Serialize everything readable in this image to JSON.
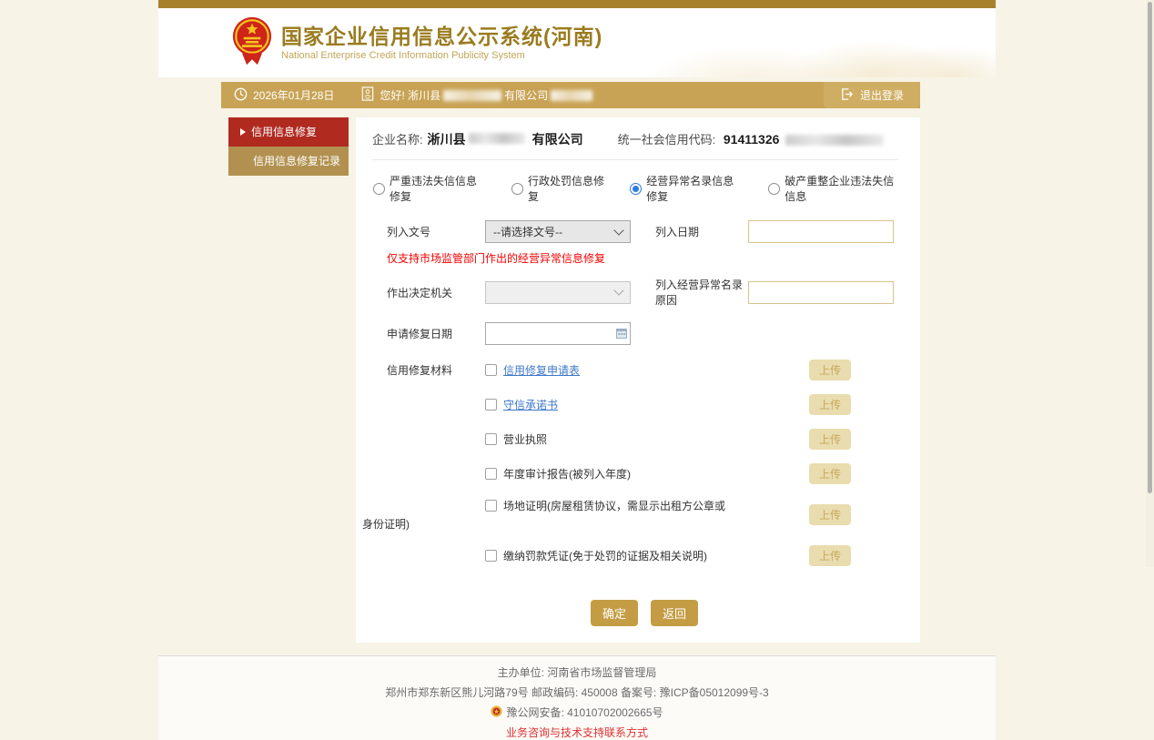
{
  "header": {
    "title": "国家企业信用信息公示系统(河南)",
    "subtitle": "National Enterprise Credit Information Publicity System"
  },
  "navbar": {
    "date": "2026年01月28日",
    "greeting_prefix": "您好! 淅川县",
    "greeting_suffix": "有限公司",
    "logout_label": "退出登录"
  },
  "sidebar": {
    "items": [
      {
        "label": "信用信息修复",
        "active": true
      },
      {
        "label": "信用信息修复记录",
        "active": false
      }
    ]
  },
  "form": {
    "company_label": "企业名称:",
    "company_name_prefix": "淅川县",
    "company_name_suffix": "有限公司",
    "credit_code_label": "统一社会信用代码:",
    "credit_code_visible": "91411326",
    "radios": [
      {
        "label": "严重违法失信信息修复",
        "selected": false
      },
      {
        "label": "行政处罚信息修复",
        "selected": false
      },
      {
        "label": "经营异常名录信息修复",
        "selected": true
      },
      {
        "label": "破产重整企业违法失信信息",
        "selected": false
      }
    ],
    "fields": {
      "doc_no_label": "列入文号",
      "doc_no_value": "--请选择文号--",
      "list_date_label": "列入日期",
      "list_date_value": "",
      "notice": "仅支持市场监管部门作出的经营异常信息修复",
      "authority_label": "作出决定机关",
      "authority_value": "",
      "reason_label": "列入经营异常名录原因",
      "reason_value": "",
      "apply_date_label": "申请修复日期",
      "apply_date_value": "",
      "materials_label": "信用修复材料"
    },
    "materials": [
      {
        "label": "信用修复申请表",
        "link": true
      },
      {
        "label": "守信承诺书",
        "link": true
      },
      {
        "label": "营业执照",
        "link": false
      },
      {
        "label": "年度审计报告(被列入年度)",
        "link": false
      },
      {
        "label": "场地证明(房屋租赁协议，需显示出租方公章或",
        "label2": "身份证明)",
        "link": false
      },
      {
        "label": "缴纳罚款凭证(免于处罚的证据及相关说明)",
        "link": false
      }
    ],
    "upload_label": "上传",
    "confirm_label": "确定",
    "back_label": "返回"
  },
  "footer": {
    "line1": "主办单位: 河南省市场监督管理局",
    "line2": "郑州市郑东新区熊儿河路79号 邮政编码: 450008 备案号: 豫ICP备05012099号-3",
    "line3": "豫公网安备: 41010702002665号",
    "line4": "业务咨询与技术支持联系方式"
  },
  "colors": {
    "brand_gold": "#c8a355",
    "accent_red": "#b02a20",
    "link_blue": "#3d77c9",
    "notice_red": "#f30000",
    "radio_blue": "#2b7de0"
  }
}
